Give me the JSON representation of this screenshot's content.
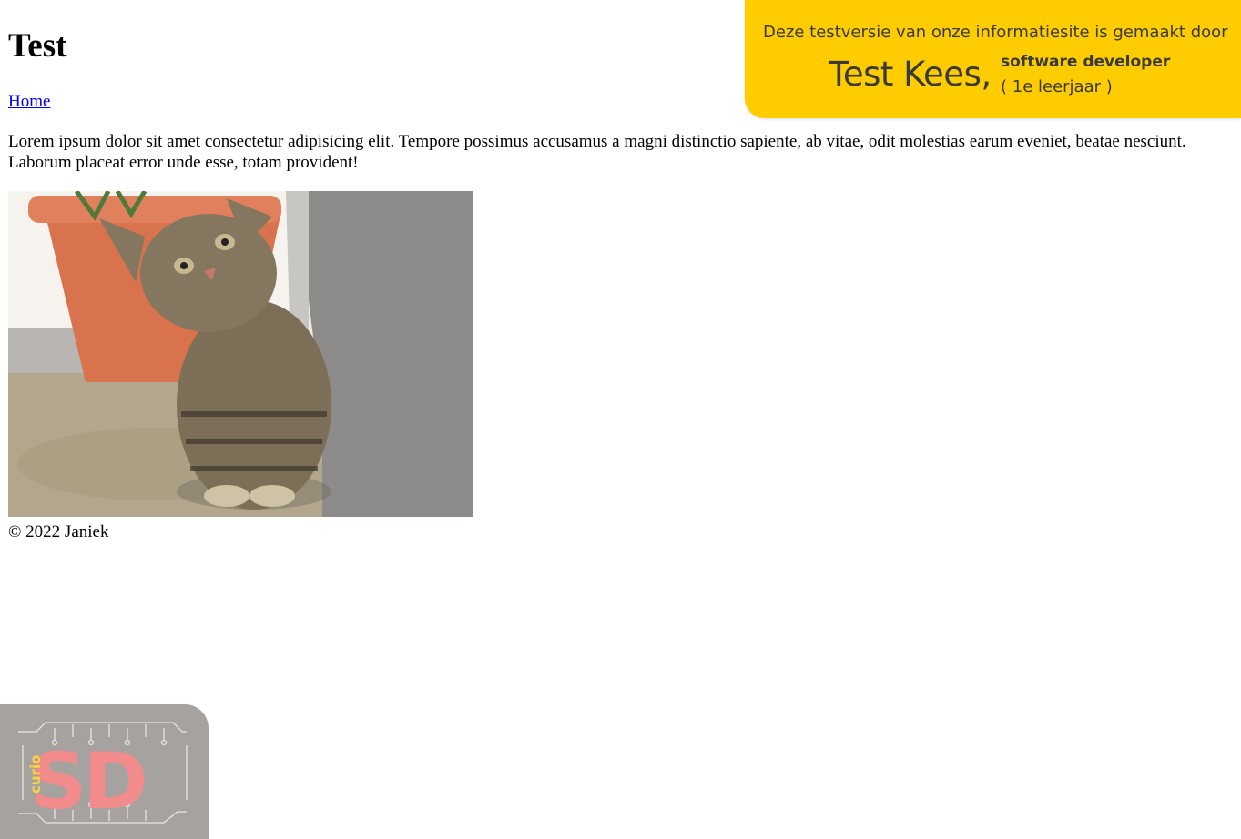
{
  "page": {
    "title": "Test",
    "nav_home": "Home",
    "intro": "Lorem ipsum dolor sit amet consectetur adipisicing elit. Tempore possimus accusamus a magni distinctio sapiente, ab vitae, odit molestias earum eveniet, beatae nesciunt. Laborum placeat error unde esse, totam provident!",
    "footer": "© 2022 Janiek"
  },
  "banner": {
    "line": "Deze testversie van onze informatiesite is gemaakt door",
    "name": "Test Kees,",
    "role": "software developer",
    "year": "( 1e leerjaar )",
    "background": "#ffcc00"
  },
  "logo": {
    "school": "curio",
    "initials": "SD",
    "background": "#a5a2a0",
    "accent": "#f28b8b",
    "school_color": "#ffd23f"
  },
  "colors": {
    "link": "#0000ee",
    "text": "#000000"
  }
}
